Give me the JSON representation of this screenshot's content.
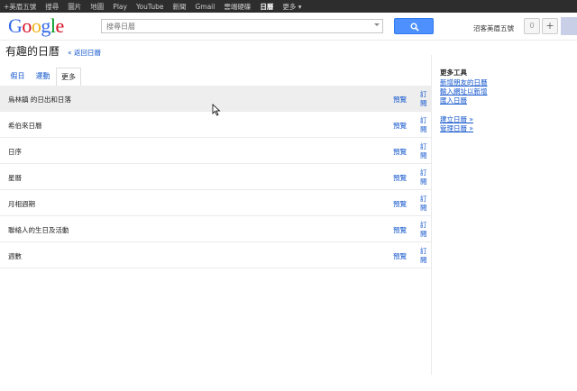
{
  "topnav": [
    "+美眉五號",
    "搜尋",
    "圖片",
    "地圖",
    "Play",
    "YouTube",
    "新聞",
    "Gmail",
    "雲端硬碟",
    "日曆",
    "更多 ▾"
  ],
  "topnav_active": 9,
  "logo": [
    "G",
    "o",
    "o",
    "g",
    "l",
    "e"
  ],
  "logo_colors": [
    "#3369e8",
    "#d50f25",
    "#eeb211",
    "#3369e8",
    "#009925",
    "#d50f25"
  ],
  "search": {
    "placeholder": "搜尋日曆"
  },
  "user": {
    "name": "沼客美眉五號",
    "notifications": "0",
    "plus_label": "+"
  },
  "page": {
    "title": "有趣的日曆",
    "back_link": "« 返回日曆"
  },
  "tabs": [
    "假日",
    "運動",
    "更多"
  ],
  "active_tab": 2,
  "rows": [
    {
      "name": "烏林鎮 的日出和日落",
      "preview": "預覽",
      "subscribe": "訂閱"
    },
    {
      "name": "希伯來日曆",
      "preview": "預覽",
      "subscribe": "訂閱"
    },
    {
      "name": "日序",
      "preview": "預覽",
      "subscribe": "訂閱"
    },
    {
      "name": "星曆",
      "preview": "預覽",
      "subscribe": "訂閱"
    },
    {
      "name": "月相週期",
      "preview": "預覽",
      "subscribe": "訂閱"
    },
    {
      "name": "聯絡人的生日及活動",
      "preview": "預覽",
      "subscribe": "訂閱"
    },
    {
      "name": "週數",
      "preview": "預覽",
      "subscribe": "訂閱"
    }
  ],
  "sidebar": {
    "heading": "更多工具",
    "links": [
      "新增朋友的日曆",
      "輸入網址以新增",
      "匯入日曆"
    ],
    "links2": [
      "建立日曆 »",
      "管理日曆 »"
    ]
  },
  "colors": {
    "accent": "#4d90fe",
    "link": "#1155cc",
    "topbar": "#2d2d2d"
  }
}
